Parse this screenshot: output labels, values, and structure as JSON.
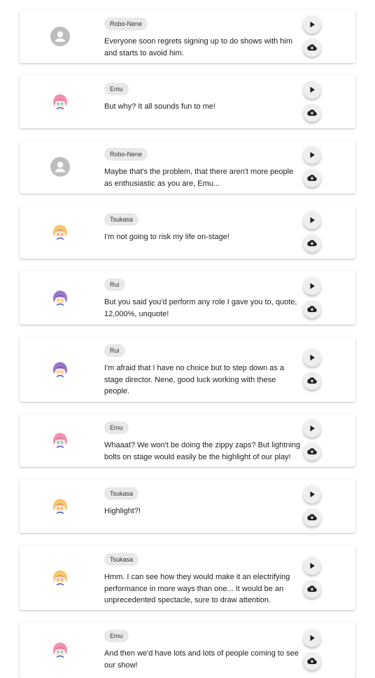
{
  "colors": {
    "accent": "#212121",
    "chip_bg": "#e8e8e8",
    "default_avatar": "#bdbdbd"
  },
  "lines": [
    {
      "speaker": "Robo-Nene",
      "avatar": "default-avatar-icon",
      "text": "Everyone soon regrets signing up to do shows with him and starts to avoid him."
    },
    {
      "speaker": "Emu",
      "avatar": "emu-avatar-icon",
      "text": "But why? It all sounds fun to me!"
    },
    {
      "speaker": "Robo-Nene",
      "avatar": "default-avatar-icon",
      "text": "Maybe that's the problem, that there aren't more people as enthusiastic as you are, Emu..."
    },
    {
      "speaker": "Tsukasa",
      "avatar": "tsukasa-avatar-icon",
      "text": "I'm not going to risk my life on-stage!"
    },
    {
      "speaker": "Rui",
      "avatar": "rui-avatar-icon",
      "text": "But you said you'd perform any role I gave you to, quote, 12,000%, unquote!"
    },
    {
      "speaker": "Rui",
      "avatar": "rui-avatar-icon",
      "text": "I'm afraid that I have no choice but to step down as a stage director. Nene, good luck working with these people."
    },
    {
      "speaker": "Emu",
      "avatar": "emu-avatar-icon",
      "text": "Whaaat? We won't be doing the zippy zaps? But lightning bolts on stage would easily be the highlight of our play!"
    },
    {
      "speaker": "Tsukasa",
      "avatar": "tsukasa-avatar-icon",
      "text": "Highlight?!"
    },
    {
      "speaker": "Tsukasa",
      "avatar": "tsukasa-avatar-icon",
      "text": "Hmm. I can see how they would make it an electrifying performance in more ways than one... It would be an unprecedented spectacle, sure to draw attention."
    },
    {
      "speaker": "Emu",
      "avatar": "emu-avatar-icon",
      "text": "And then we'd have lots and lots of people coming to see our show!"
    }
  ]
}
